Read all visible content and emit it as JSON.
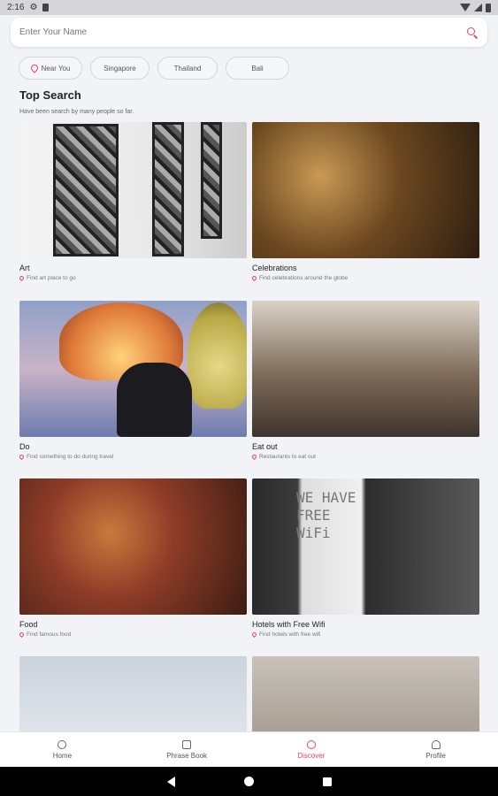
{
  "status_bar": {
    "time": "2:16"
  },
  "search": {
    "placeholder": "Enter Your Name"
  },
  "chips": [
    {
      "label": "Near You",
      "icon": "location-pin-icon"
    },
    {
      "label": "Singapore"
    },
    {
      "label": "Thailand"
    },
    {
      "label": "Bali"
    }
  ],
  "section": {
    "title": "Top Search",
    "subtitle": "Have been search by many people so far."
  },
  "cards": [
    {
      "title": "Art",
      "subtitle": "Find art place to go"
    },
    {
      "title": "Celebrations",
      "subtitle": "Find celebrations around the globe"
    },
    {
      "title": "Do",
      "subtitle": "Find something to do during travel"
    },
    {
      "title": "Eat out",
      "subtitle": "Restaurants to eat out"
    },
    {
      "title": "Food",
      "subtitle": "Find famous food"
    },
    {
      "title": "Hotels with Free Wifi",
      "subtitle": "Find hotels with free wifi",
      "sign_text": "WE HAVE FREE WiFi"
    },
    {
      "title": "",
      "subtitle": ""
    },
    {
      "title": "",
      "subtitle": ""
    }
  ],
  "bottom_nav": [
    {
      "label": "Home",
      "icon": "home-icon"
    },
    {
      "label": "Phrase Book",
      "icon": "phrase-book-icon"
    },
    {
      "label": "Discover",
      "icon": "discover-icon",
      "active": true
    },
    {
      "label": "Profile",
      "icon": "profile-icon"
    }
  ],
  "colors": {
    "accent": "#e8435f",
    "background": "#f2f3f7"
  }
}
